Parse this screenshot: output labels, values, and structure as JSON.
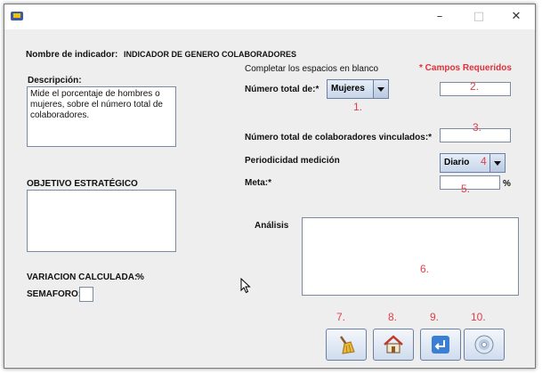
{
  "window": {
    "min_glyph": "–",
    "max_glyph": "□",
    "close_glyph": "✕"
  },
  "indicator": {
    "label": "Nombre de indicador:",
    "value": "INDICADOR DE GENERO COLABORADORES"
  },
  "descripcion": {
    "label": "Descripción:",
    "text": "Mide el porcentaje de hombres o mujeres, sobre el número total de colaboradores."
  },
  "instructions": "Completar los espacios en blanco",
  "required_note": "* Campos Requeridos",
  "numero_total": {
    "label": "Número total de:*",
    "selected": "Mujeres"
  },
  "colaboradores": {
    "label": "Número total de colaboradores vinculados:*"
  },
  "periodicidad": {
    "label": "Periodicidad medición",
    "selected": "Diario"
  },
  "meta": {
    "label": "Meta:*",
    "unit": "%"
  },
  "objetivo": {
    "label": "OBJETIVO ESTRATÉGICO"
  },
  "analisis": {
    "label": "Análisis"
  },
  "variacion": {
    "label": "VARIACION CALCULADA:",
    "unit": "%"
  },
  "semaforo": {
    "label": "SEMAFORO:"
  },
  "markers": [
    "1.",
    "2.",
    "3.",
    "4",
    "5.",
    "6.",
    "7.",
    "8.",
    "9.",
    "10."
  ],
  "icons": {
    "clear": "broom-icon",
    "home": "home-icon",
    "back": "return-arrow-icon",
    "save": "disc-icon"
  }
}
